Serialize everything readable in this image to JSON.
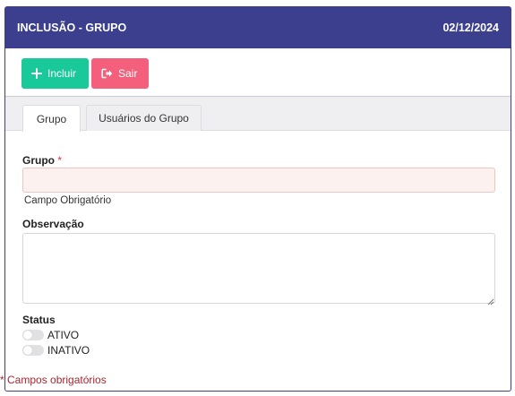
{
  "header": {
    "title": "INCLUSÃO - GRUPO",
    "date": "02/12/2024"
  },
  "toolbar": {
    "include_label": "Incluir",
    "exit_label": "Sair"
  },
  "tabs": [
    {
      "label": "Grupo",
      "active": true
    },
    {
      "label": "Usuários do Grupo",
      "active": false
    }
  ],
  "form": {
    "grupo": {
      "label": "Grupo",
      "required_mark": "*",
      "value": "",
      "hint": "Campo Obrigatório"
    },
    "observacao": {
      "label": "Observação",
      "value": ""
    },
    "status": {
      "label": "Status",
      "options": [
        {
          "label": "ATIVO",
          "on": false
        },
        {
          "label": "INATIVO",
          "on": false
        }
      ]
    }
  },
  "footer": {
    "required_note": "* Campos obrigatórios"
  },
  "colors": {
    "header": "#3b3f8e",
    "include_button": "#19c99a",
    "exit_button": "#f4607b",
    "required": "#d9303e"
  }
}
